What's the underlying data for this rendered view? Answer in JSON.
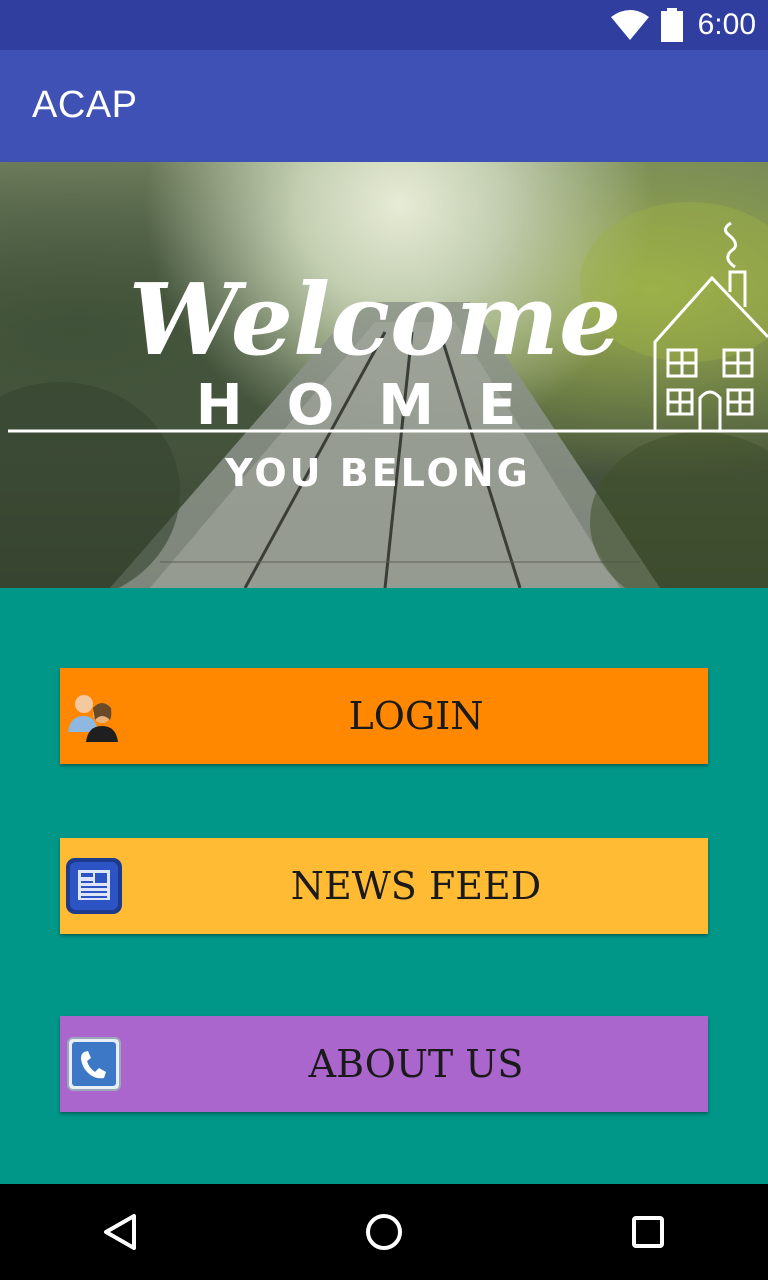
{
  "status_bar": {
    "time": "6:00",
    "icons": [
      "wifi-icon",
      "battery-icon"
    ]
  },
  "app_bar": {
    "title": "ACAP"
  },
  "banner": {
    "line1": "Welcome",
    "line2": "HOME",
    "line3": "YOU BELONG"
  },
  "buttons": {
    "login": {
      "label": "LOGIN",
      "icon": "users-icon",
      "color": "#FF8800"
    },
    "news_feed": {
      "label": "NEWS FEED",
      "icon": "newspaper-icon",
      "color": "#FFBB33"
    },
    "about_us": {
      "label": "ABOUT US",
      "icon": "phone-icon",
      "color": "#AA66CC"
    }
  },
  "colors": {
    "primary": "#3F51B5",
    "primary_dark": "#303F9F",
    "background": "#009688"
  },
  "nav_bar": {
    "buttons": [
      "back-icon",
      "home-icon",
      "recents-icon"
    ]
  }
}
